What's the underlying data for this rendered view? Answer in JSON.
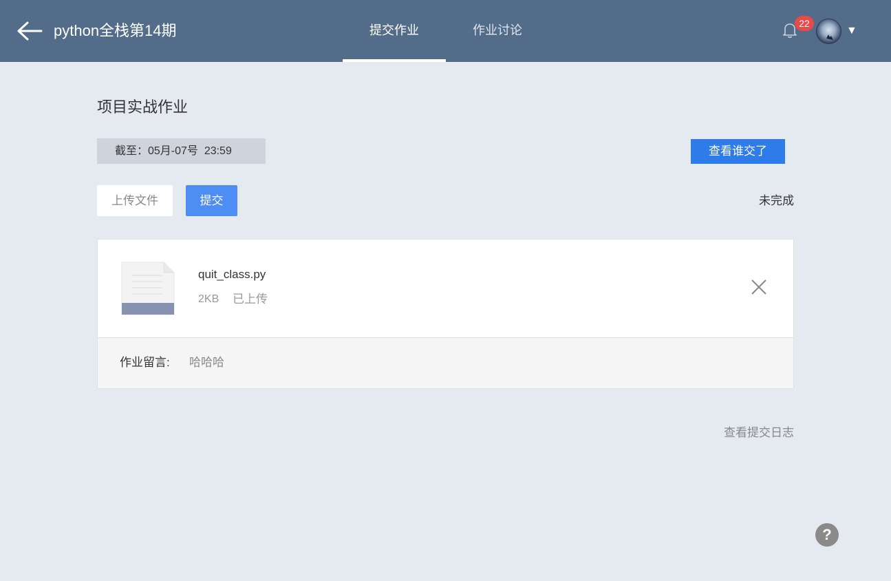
{
  "header": {
    "back_icon": "arrow-left-icon",
    "course_title": "python全栈第14期",
    "tabs": [
      {
        "label": "提交作业",
        "active": true
      },
      {
        "label": "作业讨论",
        "active": false
      }
    ],
    "notifications": {
      "icon": "bell-icon",
      "count": "22"
    },
    "avatar_icon": "avatar-moon-image",
    "menu_caret": "▼"
  },
  "assignment": {
    "title": "项目实战作业",
    "deadline": "截至：05月-07号  23:59",
    "who_submitted_label": "查看谁交了",
    "upload_label": "上传文件",
    "submit_label": "提交",
    "status": "未完成"
  },
  "file": {
    "name": "quit_class.py",
    "size": "2KB",
    "state": "已上传",
    "remove_icon": "close-icon"
  },
  "note": {
    "label": "作业留言:",
    "value": "哈哈哈"
  },
  "footer": {
    "log_link": "查看提交日志",
    "help": "?"
  },
  "colors": {
    "header_bg": "#526c89",
    "page_bg": "#e5e9f0",
    "primary_button": "#2e7bea",
    "submit_button": "#4d8ef5",
    "badge": "#e84a4a"
  }
}
